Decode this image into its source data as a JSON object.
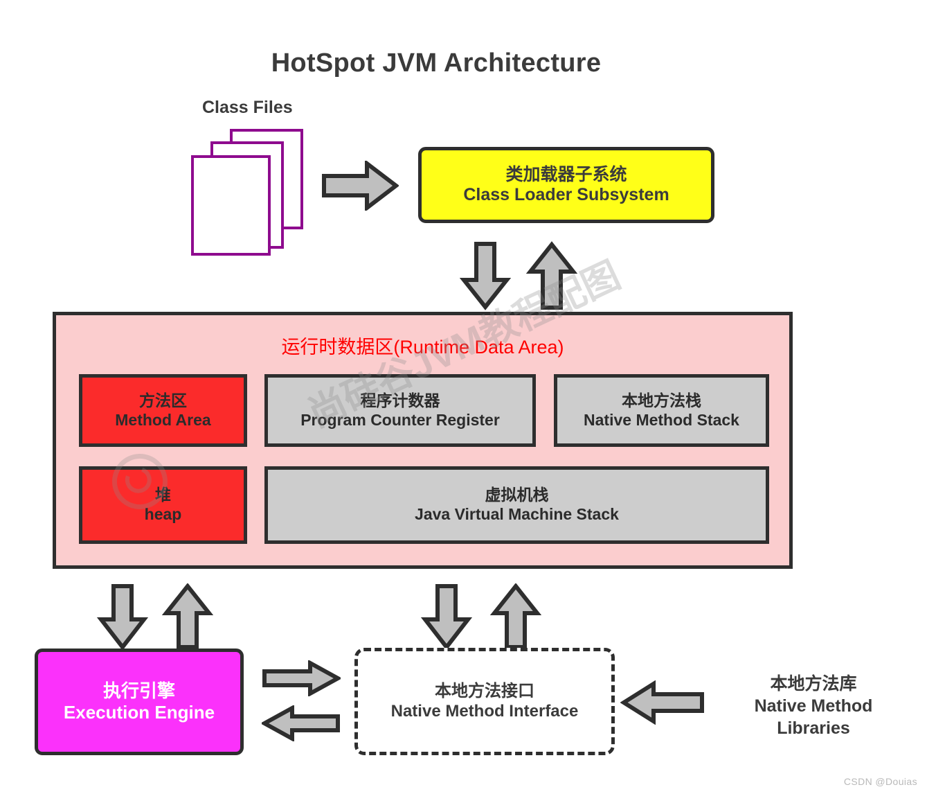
{
  "diagram": {
    "title": "HotSpot JVM Architecture",
    "class_files_label": "Class Files",
    "colors": {
      "class_loader_fill": "#ffff18",
      "runtime_area_fill": "#fbcdce",
      "runtime_area_title_color": "#ff0000",
      "red_box_fill": "#fb2b2b",
      "gray_box_fill": "#cdcdcd",
      "execution_engine_fill": "#fb31fb",
      "border": "#2e2e2e",
      "class_file_outline": "#8e0b8e",
      "arrow_fill": "#bfbfbf"
    },
    "class_loader": {
      "cn": "类加载器子系统",
      "en": "Class Loader Subsystem"
    },
    "runtime_data_area": {
      "title": "运行时数据区(Runtime Data Area)",
      "boxes": [
        {
          "cn": "方法区",
          "en": "Method Area",
          "fill": "red",
          "row": 1,
          "col": 1
        },
        {
          "cn": "程序计数器",
          "en": "Program Counter Register",
          "fill": "gray",
          "row": 1,
          "col": 2
        },
        {
          "cn": "本地方法栈",
          "en": "Native Method Stack",
          "fill": "gray",
          "row": 1,
          "col": 3
        },
        {
          "cn": "堆",
          "en": "heap",
          "fill": "red",
          "row": 2,
          "col": 1
        },
        {
          "cn": "虚拟机栈",
          "en": "Java Virtual Machine Stack",
          "fill": "gray",
          "row": 2,
          "col": 2
        }
      ]
    },
    "execution_engine": {
      "cn": "执行引擎",
      "en": "Execution Engine"
    },
    "native_method_interface": {
      "cn": "本地方法接口",
      "en": "Native Method Interface"
    },
    "native_method_libraries": {
      "cn": "本地方法库",
      "en_line1": "Native Method",
      "en_line2": "Libraries"
    },
    "arrows": [
      {
        "name": "class-files-to-class-loader",
        "direction": "right"
      },
      {
        "name": "class-loader-to-runtime-down",
        "direction": "down"
      },
      {
        "name": "runtime-to-class-loader-up",
        "direction": "up"
      },
      {
        "name": "runtime-to-execution-engine-down",
        "direction": "down"
      },
      {
        "name": "execution-engine-to-runtime-up",
        "direction": "up"
      },
      {
        "name": "runtime-to-native-interface-down",
        "direction": "down"
      },
      {
        "name": "native-interface-to-runtime-up",
        "direction": "up"
      },
      {
        "name": "execution-engine-to-native-interface-right",
        "direction": "right"
      },
      {
        "name": "native-interface-to-execution-engine-left",
        "direction": "left"
      },
      {
        "name": "native-libraries-to-native-interface-left",
        "direction": "left"
      }
    ],
    "watermarks": {
      "center": "尚硅谷JVM教程配图",
      "corner": "CSDN @Douias"
    }
  }
}
